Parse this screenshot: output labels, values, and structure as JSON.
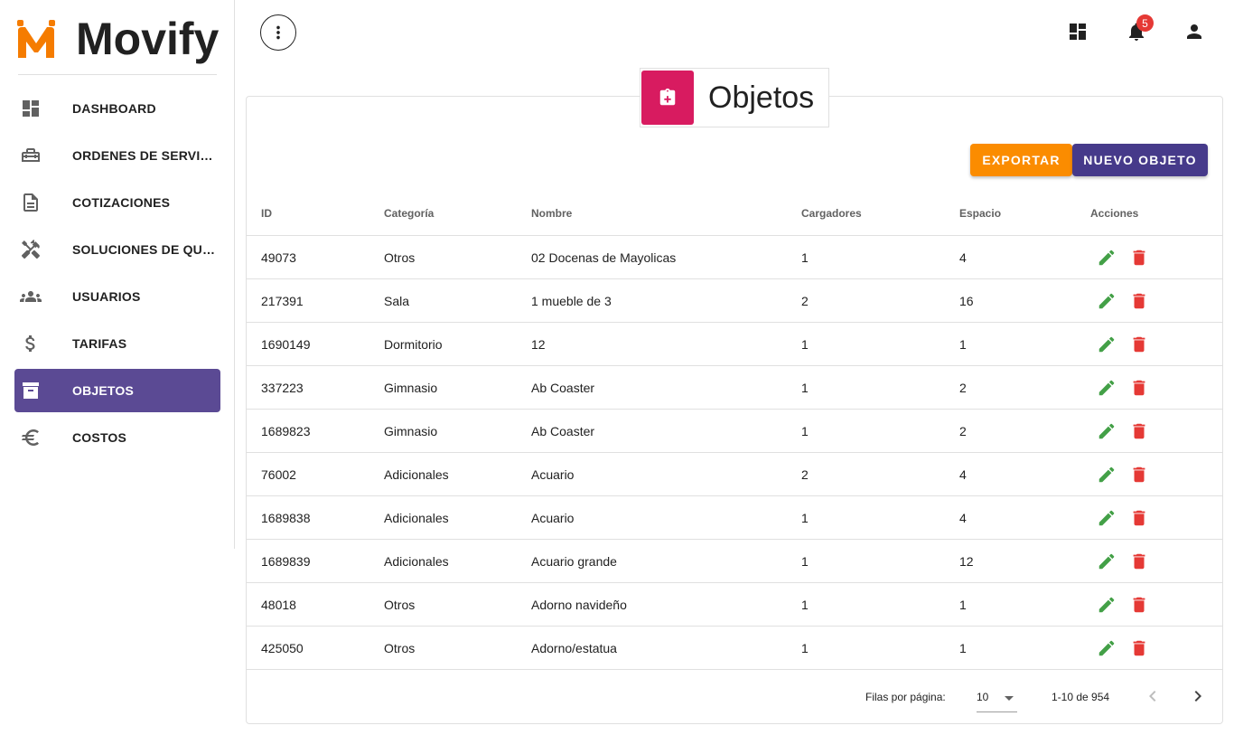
{
  "app": {
    "name": "Movify",
    "brand_color": "#f57c00"
  },
  "sidebar": {
    "items": [
      {
        "label": "DASHBOARD",
        "icon": "dashboard-icon"
      },
      {
        "label": "ORDENES DE SERVICIO",
        "icon": "toolbox-icon"
      },
      {
        "label": "COTIZACIONES",
        "icon": "document-icon"
      },
      {
        "label": "SOLUCIONES DE QUIEBRE",
        "icon": "tools-icon"
      },
      {
        "label": "USUARIOS",
        "icon": "users-icon"
      },
      {
        "label": "TARIFAS",
        "icon": "dollar-icon"
      },
      {
        "label": "OBJETOS",
        "icon": "archive-icon",
        "active": true
      },
      {
        "label": "COSTOS",
        "icon": "euro-icon"
      }
    ],
    "active_color": "#5b4a94"
  },
  "topbar": {
    "notifications_count": "5"
  },
  "page": {
    "title": "Objetos",
    "header_icon": "clipboard-plus-icon",
    "header_color": "#d81b60",
    "export_label": "EXPORTAR",
    "new_label": "NUEVO OBJETO"
  },
  "table": {
    "headers": [
      "ID",
      "Categoría",
      "Nombre",
      "Cargadores",
      "Espacio",
      "Acciones"
    ],
    "rows": [
      [
        "49073",
        "Otros",
        "02 Docenas de Mayolicas",
        "1",
        "4"
      ],
      [
        "217391",
        "Sala",
        "1 mueble de 3",
        "2",
        "16"
      ],
      [
        "1690149",
        "Dormitorio",
        "12",
        "1",
        "1"
      ],
      [
        "337223",
        "Gimnasio",
        "Ab Coaster",
        "1",
        "2"
      ],
      [
        "1689823",
        "Gimnasio",
        "Ab Coaster",
        "1",
        "2"
      ],
      [
        "76002",
        "Adicionales",
        "Acuario",
        "2",
        "4"
      ],
      [
        "1689838",
        "Adicionales",
        "Acuario",
        "1",
        "4"
      ],
      [
        "1689839",
        "Adicionales",
        "Acuario grande",
        "1",
        "12"
      ],
      [
        "48018",
        "Otros",
        "Adorno navideño",
        "1",
        "1"
      ],
      [
        "425050",
        "Otros",
        "Adorno/estatua",
        "1",
        "1"
      ]
    ]
  },
  "pagination": {
    "rows_per_page_label": "Filas por página:",
    "rows_per_page": "10",
    "range": "1-10 de 954"
  }
}
